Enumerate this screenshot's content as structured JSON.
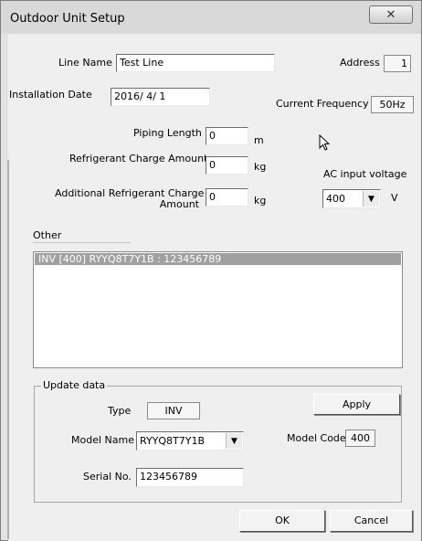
{
  "window": {
    "title": "Outdoor Unit Setup",
    "close_glyph": "✕"
  },
  "line_name": {
    "label": "Line Name",
    "value": "Test Line"
  },
  "address": {
    "label": "Address",
    "value": "1"
  },
  "installation_date": {
    "label": "Installation Date",
    "value": "2016/ 4/ 1"
  },
  "current_frequency": {
    "label": "Current Frequency",
    "value": "50Hz"
  },
  "piping_length": {
    "label": "Piping Length",
    "value": "0",
    "unit": "m"
  },
  "refrigerant_charge": {
    "label": "Refrigerant Charge Amount",
    "value": "0",
    "unit": "kg"
  },
  "additional_refrigerant": {
    "label_line1": "Additional Refrigerant Charge",
    "label_line2": "Amount",
    "value": "0",
    "unit": "kg"
  },
  "ac_input_voltage": {
    "label": "AC input voltage",
    "value": "400",
    "unit": "V"
  },
  "other": {
    "label": "Other",
    "items": [
      "INV  [400]  RYYQ8T7Y1B   : 123456789"
    ]
  },
  "update_data": {
    "label": "Update data",
    "type_label": "Type",
    "type_value": "INV",
    "apply_label": "Apply",
    "model_name_label": "Model Name",
    "model_name_value": "RYYQ8T7Y1B",
    "model_code_label": "Model Code",
    "model_code_value": "400",
    "serial_label": "Serial No.",
    "serial_value": "123456789"
  },
  "buttons": {
    "ok": "OK",
    "cancel": "Cancel"
  },
  "icons": {
    "close": "close-icon",
    "dropdown": "chevron-down-icon",
    "cursor": "mouse-pointer-icon"
  }
}
